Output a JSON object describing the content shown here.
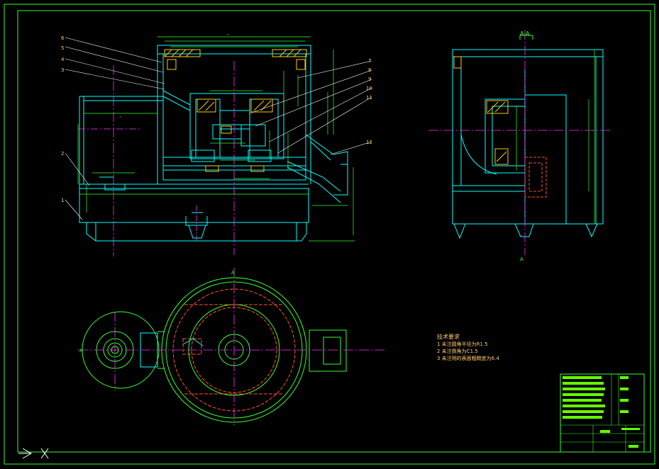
{
  "colors": {
    "background": "#000000",
    "border": "#33ff33",
    "outline": "#00ffff",
    "green": "#33ff33",
    "centerline": "#ff33ff",
    "hidden": "#ff5522",
    "hatch": "#ffcc00",
    "leader": "#ffffff",
    "text": "#ffcc66",
    "title_fill": "#66ff00"
  },
  "section_label": "A-A",
  "view_markers": {
    "a_top": "A",
    "a_bottom": "A",
    "a_left": "A"
  },
  "part_numbers": {
    "left": [
      "6",
      "5",
      "4",
      "3",
      "2",
      "1"
    ],
    "right": [
      "7",
      "8",
      "9",
      "10",
      "11",
      "12"
    ]
  },
  "tech_requirements": {
    "title": "技术要求",
    "items": [
      "1  未注圆角半径为R1.5",
      "2  未注倒角为C1.5",
      "3  未注明的表面粗糙度为6.4"
    ]
  },
  "icons": {
    "ucs": "ucs-arrow-icon",
    "cross": "x-cross-icon"
  }
}
